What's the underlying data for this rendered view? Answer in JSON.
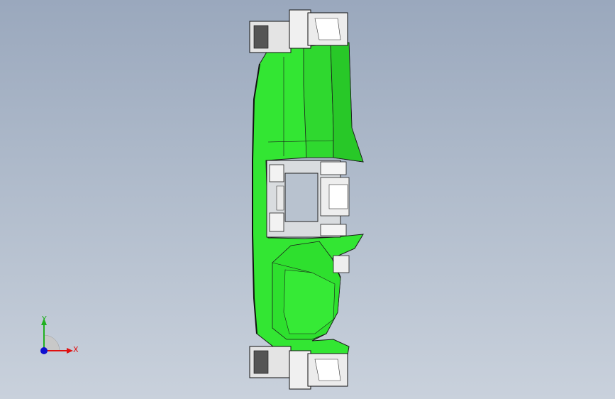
{
  "viewport": {
    "background_top": "#9aa8bd",
    "background_bottom": "#c9d1dc"
  },
  "model": {
    "part_color": "#33e633",
    "part_shade": "#22c422",
    "edge_color": "#1a1a1a",
    "hardware_color": "#e6e6e6"
  },
  "triad": {
    "x_label": "X",
    "y_label": "Y",
    "x_color": "#e01010",
    "y_color": "#20b020",
    "z_color": "#1010d0"
  }
}
